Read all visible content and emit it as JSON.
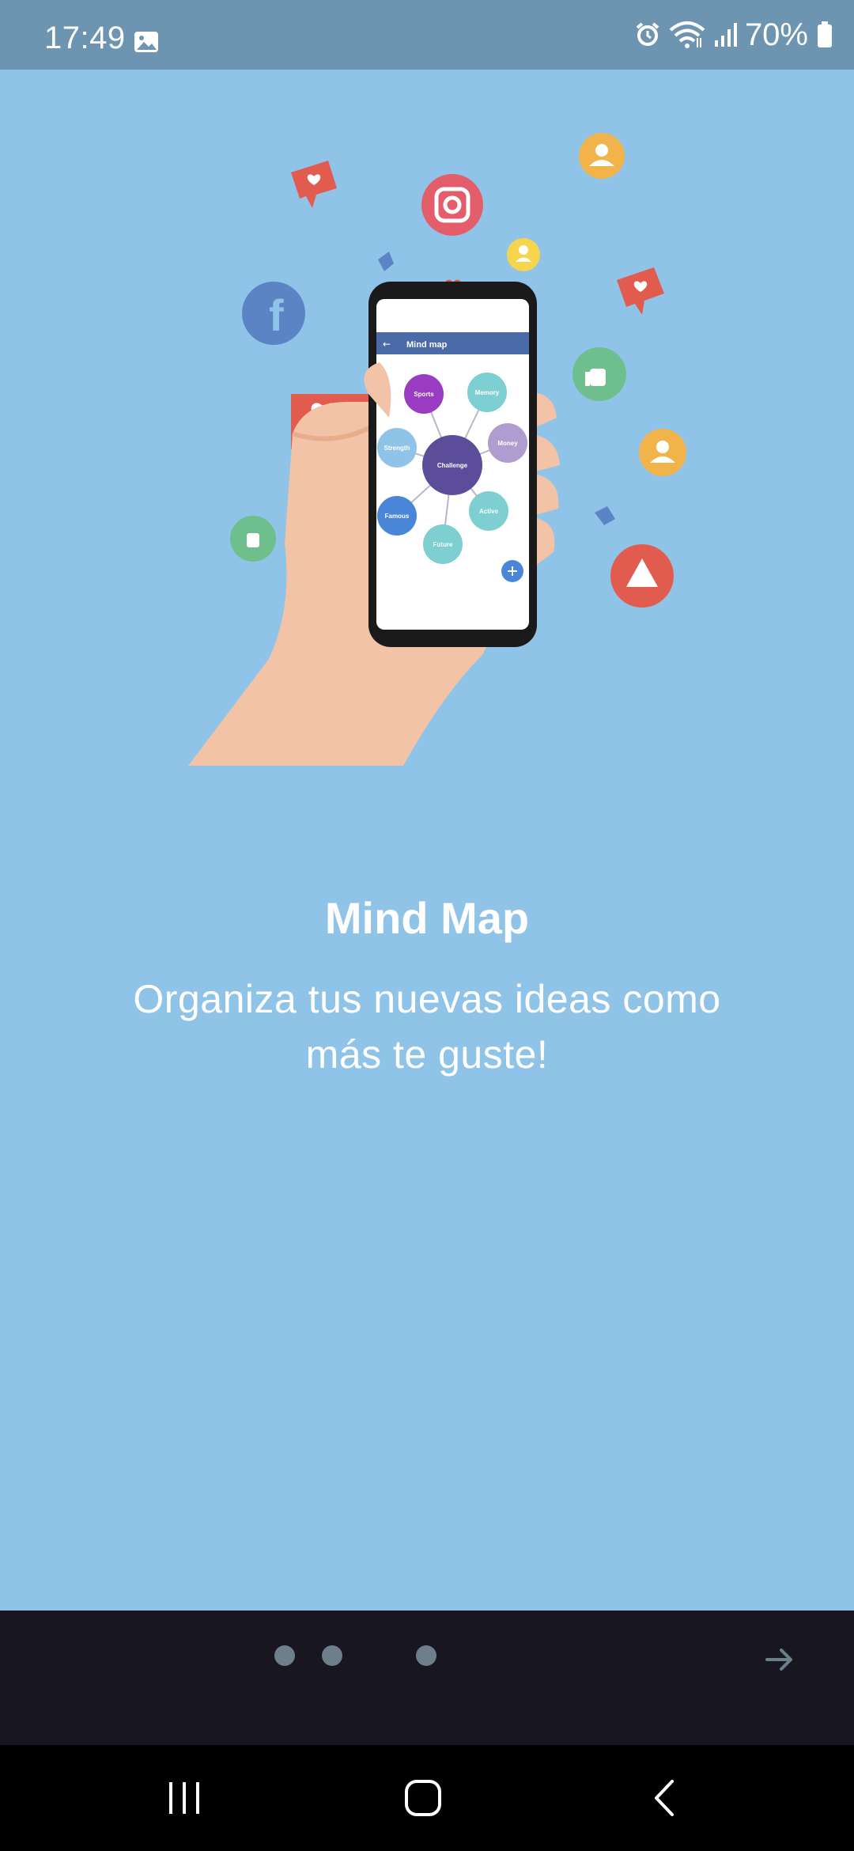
{
  "status_bar": {
    "time": "17:49",
    "battery": "70%",
    "icons": [
      "gallery-icon",
      "alarm-icon",
      "wifi-icon",
      "signal-icon",
      "battery-icon"
    ]
  },
  "onboarding": {
    "title": "Mind Map",
    "subtitle": "Organiza tus nuevas ideas como más te guste!",
    "illustration": {
      "app_bar_title": "Mind map",
      "center_node": "Challenge",
      "nodes": [
        "Sports",
        "Memory",
        "Strength",
        "Money",
        "Famous",
        "Active",
        "Future"
      ]
    }
  },
  "pager": {
    "pages": 3,
    "current_page": 1,
    "next_icon": "arrow-right-icon"
  },
  "colors": {
    "background": "#8fc4e8",
    "status_bar": "#6d95b2",
    "pager_bar": "#181620",
    "dot": "#6d7f8b"
  }
}
